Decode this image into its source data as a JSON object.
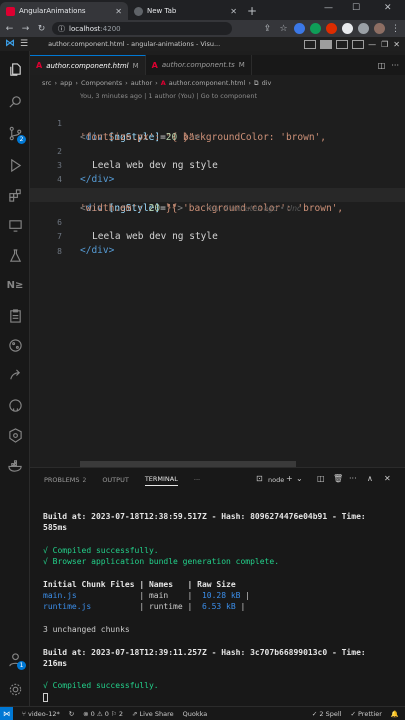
{
  "browser": {
    "tabs": [
      {
        "title": "AngularAnimations",
        "active": true
      },
      {
        "title": "New Tab",
        "active": false
      }
    ],
    "url_host": "localhost",
    "url_port": ":4200"
  },
  "vscode": {
    "window_title": "author.component.html - angular-animations - Visu..."
  },
  "editor": {
    "tabs": [
      {
        "name": "author.component.html",
        "badge": "M"
      },
      {
        "name": "author.component.ts",
        "badge": "M"
      }
    ],
    "breadcrumb": [
      "src",
      "app",
      "Components",
      "author",
      "author.component.html",
      "div"
    ],
    "codelens": "You, 3 minutes ago | 1 author (You) | Go to component",
    "lines": {
      "l1": {
        "num": "1",
        "p1": "<",
        "tag": "div",
        "attr": " [ngStyle]",
        "eq": "=",
        "s": "\"{ backgroundColor: 'brown',"
      },
      "l1b": {
        "s": "'fontSize.px': ",
        "n": "20",
        "e": " }\"",
        "close": ">"
      },
      "l2": {
        "num": "2",
        "t": "Leela web dev ng style"
      },
      "l3": {
        "num": "3",
        "tag": "</div>"
      },
      "l4": {
        "num": "4"
      },
      "l5": {
        "num": "5",
        "p1": "<",
        "tag": "div",
        "attr": " [ngStyle]",
        "eq": "=",
        "s": "\"{ 'background-color': 'brown',"
      },
      "l5b": {
        "s": "'width.em': ",
        "n": "20",
        "e": " }\"",
        "close": ">",
        "blame": "You, 4 minutes ago • Unc"
      },
      "l6": {
        "num": "6",
        "t": "Leela web dev ng style"
      },
      "l7": {
        "num": "7",
        "tag": "</div>"
      },
      "l8": {
        "num": "8"
      }
    }
  },
  "panel": {
    "tabs": [
      {
        "label": "PROBLEMS",
        "count": "2"
      },
      {
        "label": "OUTPUT"
      },
      {
        "label": "TERMINAL"
      }
    ],
    "more": "···",
    "shell": "node",
    "terminal": {
      "build1": "Build at: 2023-07-18T12:38:59.517Z - Hash: 8096274476e04b91 - Time:",
      "build1b": "585ms",
      "ok1": "√ Compiled successfully.",
      "ok2": "√ Browser application bundle generation complete.",
      "table_head": "Initial Chunk Files | Names   | Raw Size",
      "row1_file": "main.js",
      "row1_rest": "             | main    |  ",
      "row1_size": "10.28 kB",
      "row2_file": "runtime.js",
      "row2_rest": "          | runtime |  ",
      "row2_size": "6.53 kB",
      "unchanged": "3 unchanged chunks",
      "build2": "Build at: 2023-07-18T12:39:11.257Z - Hash: 3c707b66899013c0 - Time:",
      "build2b": "216ms",
      "ok3": "√ Compiled successfully."
    }
  },
  "status": {
    "branch": "video-12*",
    "errors": "⊗ 0 ⚠ 0 ⚐ 2",
    "live": "Live Share",
    "quokka": "Quokka",
    "spell": "2 Spell",
    "prettier": "✓ Prettier"
  },
  "colors": {
    "accent": "#0078d4",
    "angular": "#dd0031"
  }
}
